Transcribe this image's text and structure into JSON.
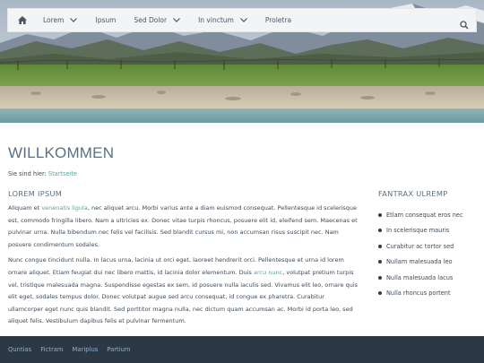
{
  "nav": {
    "home_icon": "home-icon",
    "items": [
      {
        "label": "Lorem",
        "has_dropdown": true
      },
      {
        "label": "Ipsum",
        "has_dropdown": false
      },
      {
        "label": "Sed Dolor",
        "has_dropdown": true
      },
      {
        "label": "In vinctum",
        "has_dropdown": true
      },
      {
        "label": "Proletra",
        "has_dropdown": false
      }
    ],
    "search_icon": "search-icon"
  },
  "hero": {
    "image": "mountain-lake-landscape"
  },
  "page": {
    "title": "WILLKOMMEN",
    "breadcrumb_prefix": "Sie sind hier:",
    "breadcrumb_link": "Startseite"
  },
  "main": {
    "section_title": "LOREM IPSUM",
    "p1_a": "Aliquam et ",
    "p1_link": "venenatis ligula",
    "p1_b": ", nec aliquet arcu. Morbi varius ante a diam euismod consequat. Pellentesque id scelerisque est, commodo fringilla libero. Nam a ultricies ex. Donec vitae turpis rhoncus, posuere elit id, eleifend sem. Maecenas et pulvinar urna. Nulla bibendum nec felis vel facilisis. Sed blandit cursus mi, non accumsan risus suscipit nec. Nam posuere condimentum sodales.",
    "p2_a": "Nunc congue tincidunt nulla. In lacus urna, lacinia ut orci eget, laoreet hendrerit orci. Pellentesque et urna id lorem ornare aliquet. Etiam feugiat dui nec libero mattis, id lacinia dolor elementum. Duis ",
    "p2_link": "arcu nunc",
    "p2_b": ", volutpat pretium turpis vel, tristique malesuada magna. Suspendisse egestas ex sem, id posuere nulla iaculis sed. Vivamus elit leo, ornare quis elit eget, sodales tempus dolor. Donec volutpat augue sed arcu consequat, id congue ex pharetra. Curabitur ullamcorper eget nunc quis blandit. Sed porttitor magna nulla, nec dictum quam accumsan ac. Morbi id porta leo, sed aliquet felis. Vestibulum dapibus felis et pulvinar fermentum."
  },
  "aside": {
    "title": "FANTRAX ULREMP",
    "items": [
      "Etlam consequat eros nec",
      "In scelerisque mauris",
      "Curabitur ac tortor sed",
      "Nullam malesuada leo",
      "Nulla malesuada lacus",
      "Nulla rhoncus portent"
    ]
  },
  "footer": {
    "links": [
      "Quntias",
      "Fictram",
      "Mariplus",
      "Partium"
    ]
  },
  "colors": {
    "link": "#57a49b",
    "heading": "#5a6f82",
    "footer_bg": "#2d3845",
    "footer_link": "#8fb0cf"
  }
}
